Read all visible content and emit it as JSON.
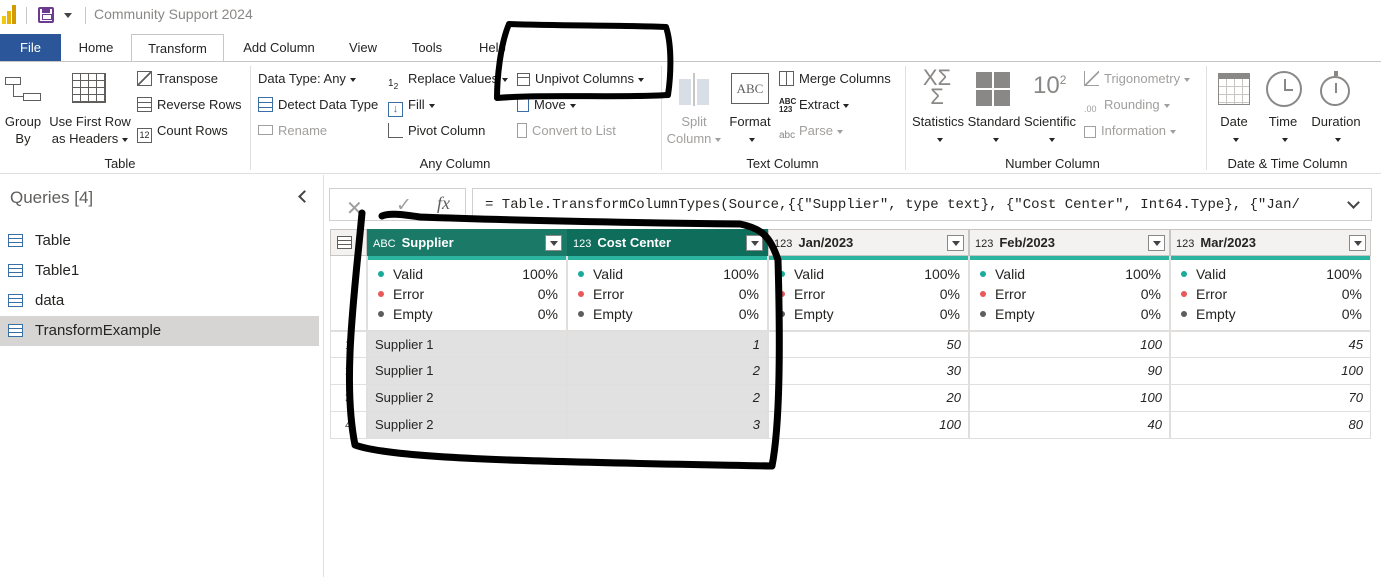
{
  "app": {
    "title": "Community Support 2024"
  },
  "tabs": [
    "File",
    "Home",
    "Transform",
    "Add Column",
    "View",
    "Tools",
    "Help"
  ],
  "active_tab": "Transform",
  "ribbon": {
    "table_group": {
      "label": "Table",
      "group_by": "Group\nBy",
      "use_first_row": "Use First Row\nas Headers",
      "transpose": "Transpose",
      "reverse_rows": "Reverse Rows",
      "count_rows": "Count Rows"
    },
    "any_column_group": {
      "label": "Any Column",
      "data_type": "Data Type: Any",
      "detect_data_type": "Detect Data Type",
      "rename": "Rename",
      "replace_values": "Replace Values",
      "fill": "Fill",
      "pivot_column": "Pivot Column",
      "unpivot_columns": "Unpivot Columns",
      "move": "Move",
      "convert_to_list": "Convert to List"
    },
    "text_column_group": {
      "label": "Text Column",
      "split_column": "Split\nColumn",
      "format": "Format",
      "merge_columns": "Merge Columns",
      "extract": "Extract",
      "parse": "Parse"
    },
    "number_column_group": {
      "label": "Number Column",
      "statistics": "Statistics",
      "standard": "Standard",
      "scientific": "Scientific",
      "trigonometry": "Trigonometry",
      "rounding": "Rounding",
      "information": "Information"
    },
    "datetime_group": {
      "label": "Date & Time Column",
      "date": "Date",
      "time": "Time",
      "duration": "Duration"
    }
  },
  "queries": {
    "header": "Queries [4]",
    "items": [
      "Table",
      "Table1",
      "data",
      "TransformExample"
    ],
    "selected": "TransformExample"
  },
  "formula": "= Table.TransformColumnTypes(Source,{{\"Supplier\", type text}, {\"Cost Center\", Int64.Type}, {\"Jan/",
  "columns": [
    {
      "name": "Supplier",
      "type": "ABC"
    },
    {
      "name": "Cost Center",
      "type": "123"
    },
    {
      "name": "Jan/2023",
      "type": "123"
    },
    {
      "name": "Feb/2023",
      "type": "123"
    },
    {
      "name": "Mar/2023",
      "type": "123"
    }
  ],
  "quality_labels": {
    "valid": "Valid",
    "error": "Error",
    "empty": "Empty"
  },
  "quality": {
    "valid": "100%",
    "error": "0%",
    "empty": "0%"
  },
  "colors": {
    "valid": "#1aab9b",
    "error": "#e8595a",
    "empty": "#605e5c"
  },
  "rows": [
    [
      "Supplier 1",
      "1",
      "50",
      "100",
      "45"
    ],
    [
      "Supplier 1",
      "2",
      "30",
      "90",
      "100"
    ],
    [
      "Supplier 2",
      "2",
      "20",
      "100",
      "70"
    ],
    [
      "Supplier 2",
      "3",
      "100",
      "40",
      "80"
    ]
  ],
  "row_numbers": [
    "1",
    "2",
    "3",
    "4"
  ]
}
